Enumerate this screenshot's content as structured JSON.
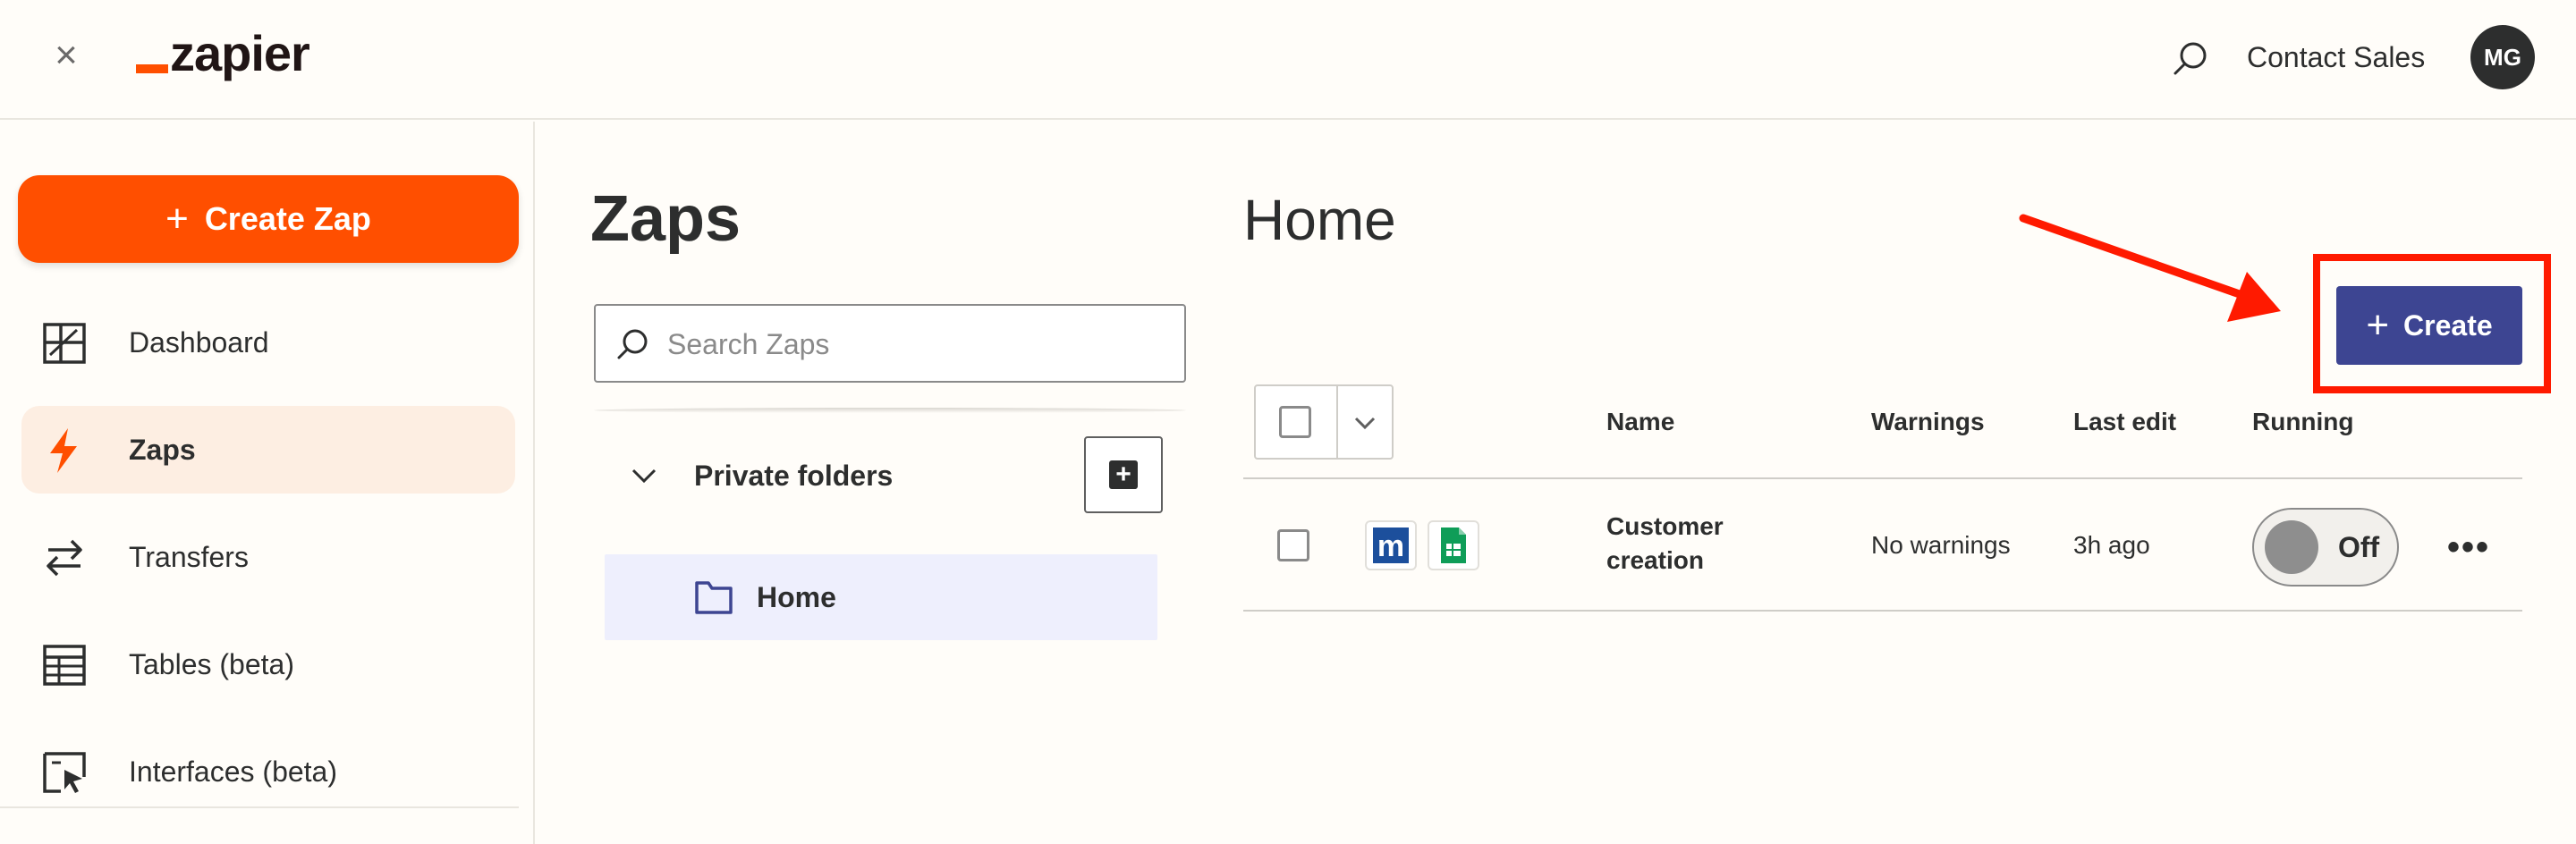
{
  "header": {
    "logo_text": "zapier",
    "contact_label": "Contact Sales",
    "avatar_initials": "MG"
  },
  "sidebar": {
    "create_label": "Create Zap",
    "items": [
      {
        "label": "Dashboard",
        "icon": "dashboard-icon"
      },
      {
        "label": "Zaps",
        "icon": "zap-icon",
        "active": true
      },
      {
        "label": "Transfers",
        "icon": "transfer-icon"
      },
      {
        "label": "Tables (beta)",
        "icon": "table-icon"
      },
      {
        "label": "Interfaces (beta)",
        "icon": "interface-icon"
      }
    ]
  },
  "zaps_panel": {
    "title": "Zaps",
    "search_placeholder": "Search Zaps",
    "private_folders_label": "Private folders",
    "home_folder_label": "Home"
  },
  "main": {
    "title": "Home",
    "create_label": "Create",
    "columns": [
      "Name",
      "Warnings",
      "Last edit",
      "Running"
    ],
    "rows": [
      {
        "name_line1": "Customer",
        "name_line2": "creation",
        "apps": [
          "m",
          "sheets"
        ],
        "warnings": "No warnings",
        "last_edit": "3h ago",
        "running_label": "Off"
      }
    ]
  },
  "colors": {
    "brand_orange": "#ff4f00",
    "create_blue": "#3d4592",
    "annotation_red": "#ff1a00"
  }
}
